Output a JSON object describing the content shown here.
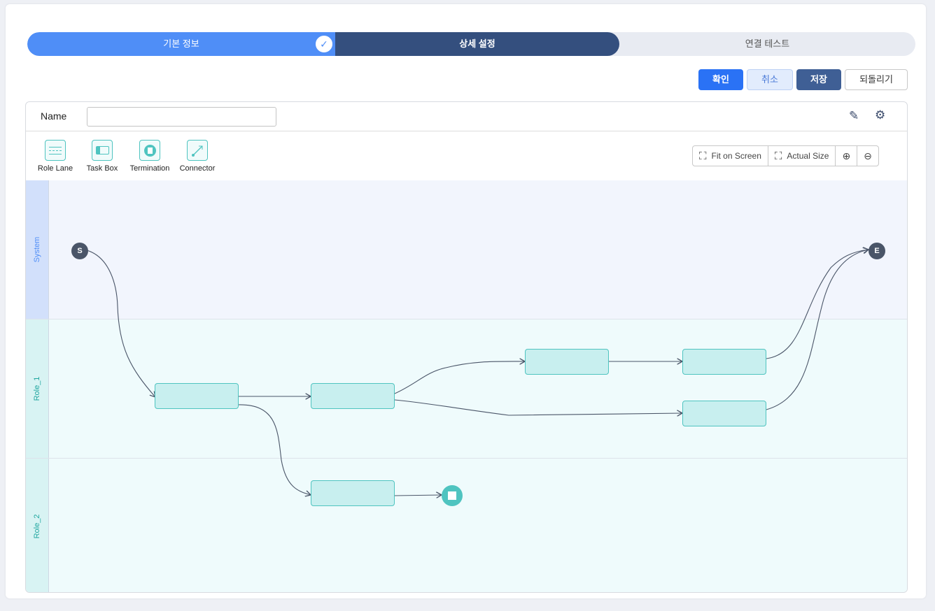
{
  "steps": [
    {
      "label": "기본 정보",
      "state": "done"
    },
    {
      "label": "상세 설정",
      "state": "active"
    },
    {
      "label": "연결 테스트",
      "state": "pending"
    }
  ],
  "actions": {
    "confirm": "확인",
    "cancel": "취소",
    "save": "저장",
    "revert": "되돌리기"
  },
  "name_field": {
    "label": "Name",
    "value": ""
  },
  "palette": [
    {
      "label": "Role Lane",
      "icon": "role-lane-icon"
    },
    {
      "label": "Task Box",
      "icon": "task-box-icon"
    },
    {
      "label": "Termination",
      "icon": "termination-icon"
    },
    {
      "label": "Connector",
      "icon": "connector-icon"
    }
  ],
  "zoom_controls": {
    "fit": "Fit on Screen",
    "actual": "Actual Size"
  },
  "lanes": [
    {
      "label": "System",
      "color": "#4f8ef7"
    },
    {
      "label": "Role_1",
      "color": "#1fa69f"
    },
    {
      "label": "Role_2",
      "color": "#1fa69f"
    }
  ],
  "nodes": {
    "start": "S",
    "end": "E"
  }
}
